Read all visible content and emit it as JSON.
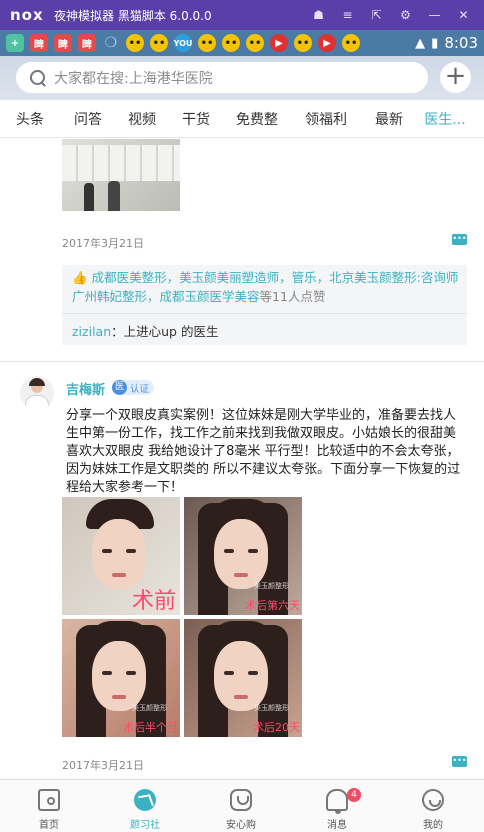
{
  "emulator": {
    "logo": "nox",
    "title": "夜神模拟器 黑猫脚本 6.0.0.0",
    "controls": [
      "☗",
      "≡",
      "⇱",
      "⚙",
      "—",
      "✕"
    ]
  },
  "status_bar": {
    "apps": [
      {
        "kind": "plus",
        "glyph": "+"
      },
      {
        "kind": "red",
        "glyph": "睥"
      },
      {
        "kind": "red",
        "glyph": "睥"
      },
      {
        "kind": "red",
        "glyph": "睥"
      },
      {
        "kind": "ear",
        "glyph": "❍"
      },
      {
        "kind": "face",
        "glyph": "••"
      },
      {
        "kind": "face",
        "glyph": "••"
      },
      {
        "kind": "blue",
        "glyph": "YOU"
      },
      {
        "kind": "face",
        "glyph": "••"
      },
      {
        "kind": "face",
        "glyph": "••"
      },
      {
        "kind": "face",
        "glyph": "••"
      },
      {
        "kind": "play",
        "glyph": "▶"
      },
      {
        "kind": "face",
        "glyph": "••"
      },
      {
        "kind": "play",
        "glyph": "▶"
      },
      {
        "kind": "face",
        "glyph": "••"
      }
    ],
    "wifi": "▲",
    "battery": "▮",
    "time": "8:03"
  },
  "search": {
    "placeholder": "大家都在搜:上海港华医院",
    "add_label": "+"
  },
  "tabs": [
    "头条",
    "问答",
    "视频",
    "干货",
    "免费整",
    "领福利",
    "最新",
    "医生..."
  ],
  "feed": {
    "post1": {
      "date": "2017年3月21日",
      "likes_names": [
        "成都医美整形",
        "美玉颜美丽塑造师",
        "管乐",
        "北京美玉颜整形:咨询师",
        "广州韩妃整形",
        "成都玉颜医学美容"
      ],
      "likes_suffix": "等11人点赞",
      "reply_user": "zizilan",
      "reply_text": "：上进心up 的医生"
    },
    "post2": {
      "author": "吉梅斯",
      "badge_icon": "医",
      "badge_text": "认证",
      "text": "分享一个双眼皮真实案例！这位妹妹是刚大学毕业的，准备要去找人生中第一份工作，找工作之前来找到我做双眼皮。小姑娘长的很甜美 喜欢大双眼皮 我给她设计了8毫米 平行型！比较适中的不会太夸张，因为妹妹工作是文职类的 所以不建议太夸张。下面分享一下恢复的过程给大家参考一下！",
      "photos": [
        {
          "caption": "术前",
          "watermark": ""
        },
        {
          "caption": "术后第六天",
          "watermark": "美玉颜整形"
        },
        {
          "caption": "术后半个月",
          "watermark": "美玉颜整形"
        },
        {
          "caption": "术后20天",
          "watermark": "美玉颜整形"
        }
      ],
      "date": "2017年3月21日"
    },
    "comment_icon_glyph": "•••"
  },
  "bottom_nav": {
    "items": [
      "首页",
      "颜习社",
      "安心购",
      "消息",
      "我的"
    ],
    "message_badge": "4"
  }
}
